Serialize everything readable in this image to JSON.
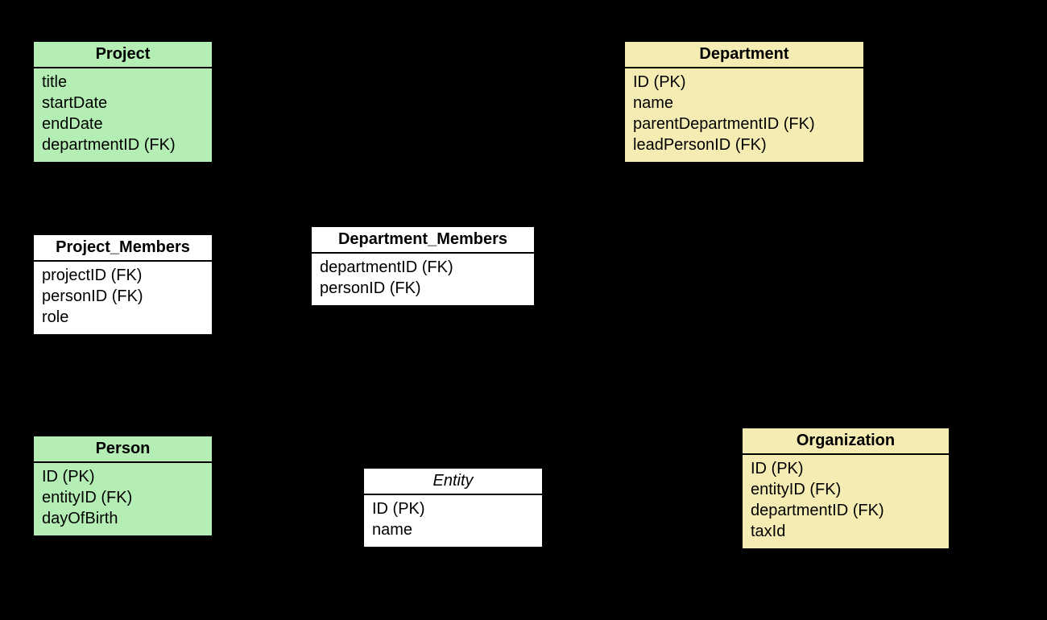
{
  "colors": {
    "green": "#b4eeb4",
    "yellow": "#f5ecb4",
    "white": "#ffffff"
  },
  "entities": {
    "project": {
      "title": "Project",
      "attrs": [
        "title",
        "startDate",
        "endDate",
        "departmentID (FK)"
      ]
    },
    "department": {
      "title": "Department",
      "attrs": [
        "ID (PK)",
        "name",
        "parentDepartmentID (FK)",
        "leadPersonID (FK)"
      ]
    },
    "project_members": {
      "title": "Project_Members",
      "attrs": [
        "projectID (FK)",
        "personID (FK)",
        "role"
      ]
    },
    "department_members": {
      "title": "Department_Members",
      "attrs": [
        "departmentID (FK)",
        "personID (FK)"
      ]
    },
    "person": {
      "title": "Person",
      "attrs": [
        "ID (PK)",
        "entityID (FK)",
        "dayOfBirth"
      ]
    },
    "entity": {
      "title": "Entity",
      "attrs": [
        "ID (PK)",
        "name"
      ]
    },
    "organization": {
      "title": "Organization",
      "attrs": [
        "ID (PK)",
        "entityID (FK)",
        "departmentID (FK)",
        "taxId"
      ]
    }
  }
}
